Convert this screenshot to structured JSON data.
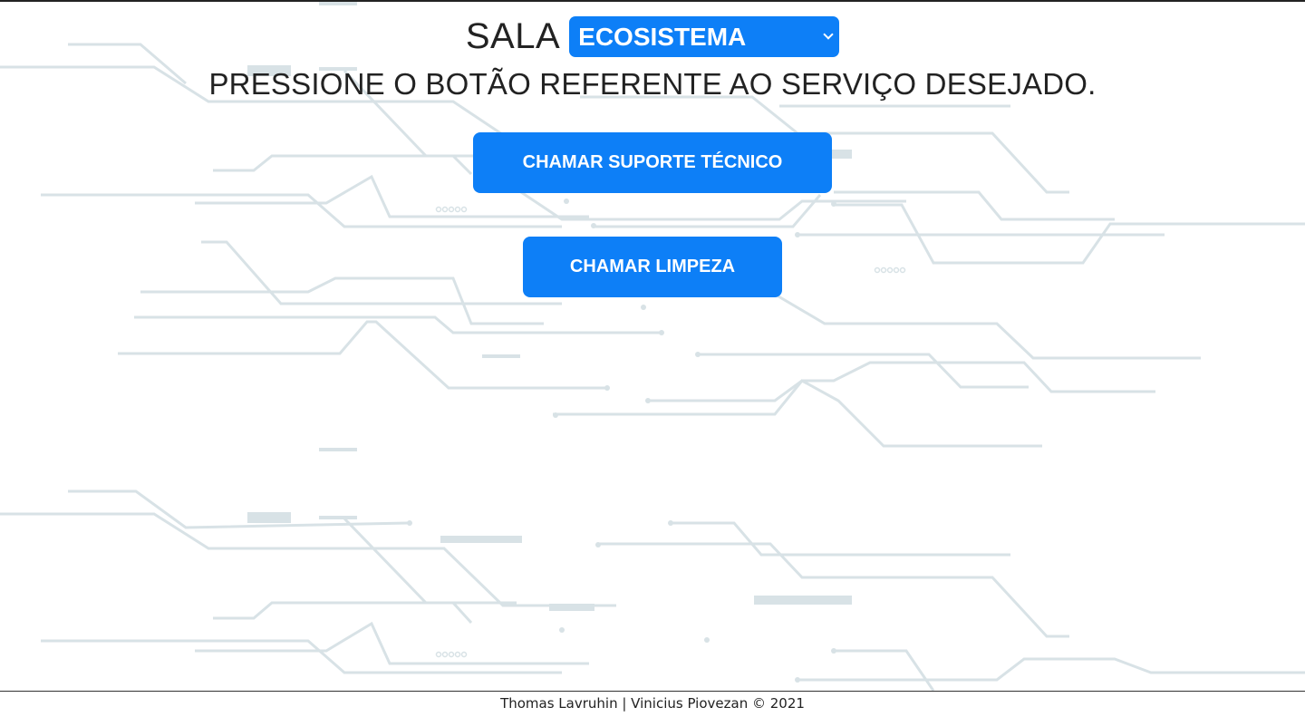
{
  "header": {
    "sala_label": "SALA",
    "room_select": {
      "selected": "ECOSISTEMA",
      "icon": "chevron-down-icon"
    }
  },
  "instruction": "PRESSIONE O BOTÃO REFERENTE AO SERVIÇO DESEJADO.",
  "actions": {
    "support_label": "CHAMAR SUPORTE TÉCNICO",
    "cleaning_label": "CHAMAR LIMPEZA"
  },
  "footer": {
    "credits": "Thomas Lavruhin | Vinicius Piovezan © 2021"
  },
  "colors": {
    "primary": "#0d7ff7",
    "circuit": "#d8e2e6",
    "text": "#222222"
  }
}
